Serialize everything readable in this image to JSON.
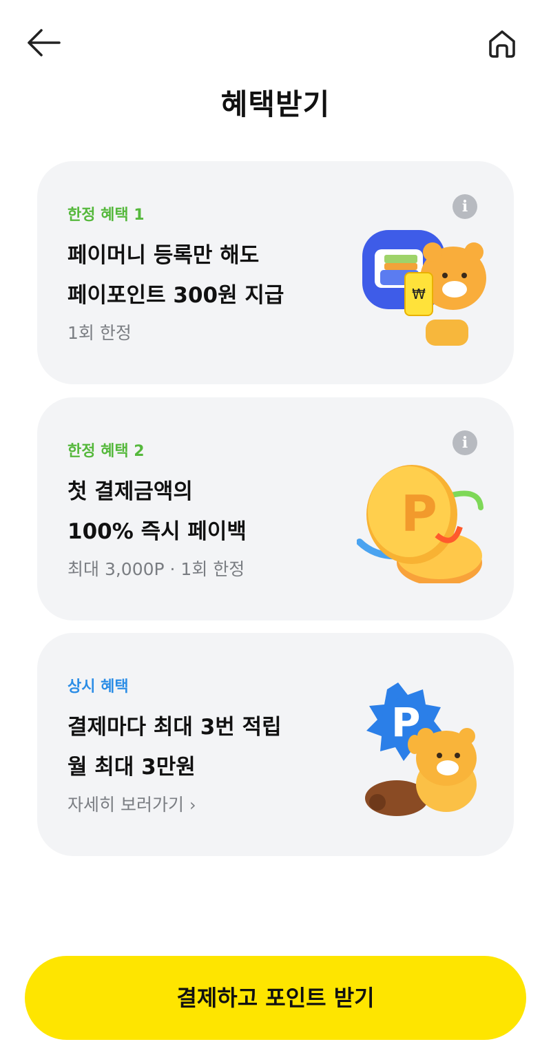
{
  "header": {
    "back_icon": "arrow-left-icon",
    "home_icon": "home-icon",
    "title": "혜택받기"
  },
  "cards": [
    {
      "tag": "한정 혜택 1",
      "tag_color": "#55b83c",
      "line1": "페이머니 등록만 해도",
      "line2": "페이포인트 300원 지급",
      "sub": "1회 한정",
      "info_icon": "info-icon",
      "illustration": "wallet-lion-icon"
    },
    {
      "tag": "한정 혜택 2",
      "tag_color": "#55b83c",
      "line1": "첫 결제금액의",
      "line2": "100% 즉시 페이백",
      "sub": "최대 3,000P · 1회 한정",
      "info_icon": "info-icon",
      "illustration": "point-coin-icon"
    },
    {
      "tag": "상시 혜택",
      "tag_color": "#2b8de6",
      "line1": "결제마다 최대 3번 적립",
      "line2": "월 최대 3만원",
      "sub": "자세히 보러가기",
      "sub_icon": "chevron-right-icon",
      "illustration": "point-badge-lion-icon"
    }
  ],
  "cta": {
    "label": "결제하고 포인트 받기",
    "color": "#fee500"
  },
  "colors": {
    "card_bg": "#f3f4f6",
    "sub_text": "#7a7d82"
  }
}
